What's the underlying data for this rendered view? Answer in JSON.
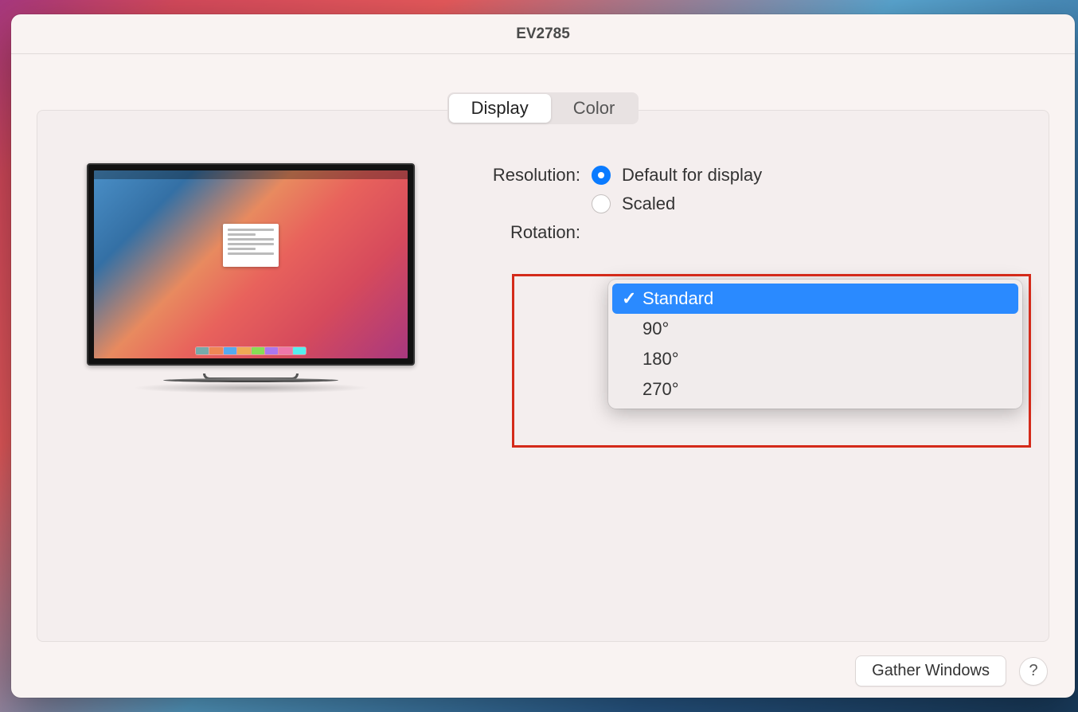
{
  "window": {
    "title": "EV2785"
  },
  "tabs": {
    "display": "Display",
    "color": "Color"
  },
  "labels": {
    "resolution": "Resolution:",
    "rotation": "Rotation:"
  },
  "resolution": {
    "default": "Default for display",
    "scaled": "Scaled"
  },
  "rotation_menu": {
    "standard": "Standard",
    "r90": "90°",
    "r180": "180°",
    "r270": "270°"
  },
  "footer": {
    "gather": "Gather Windows",
    "help": "?"
  }
}
